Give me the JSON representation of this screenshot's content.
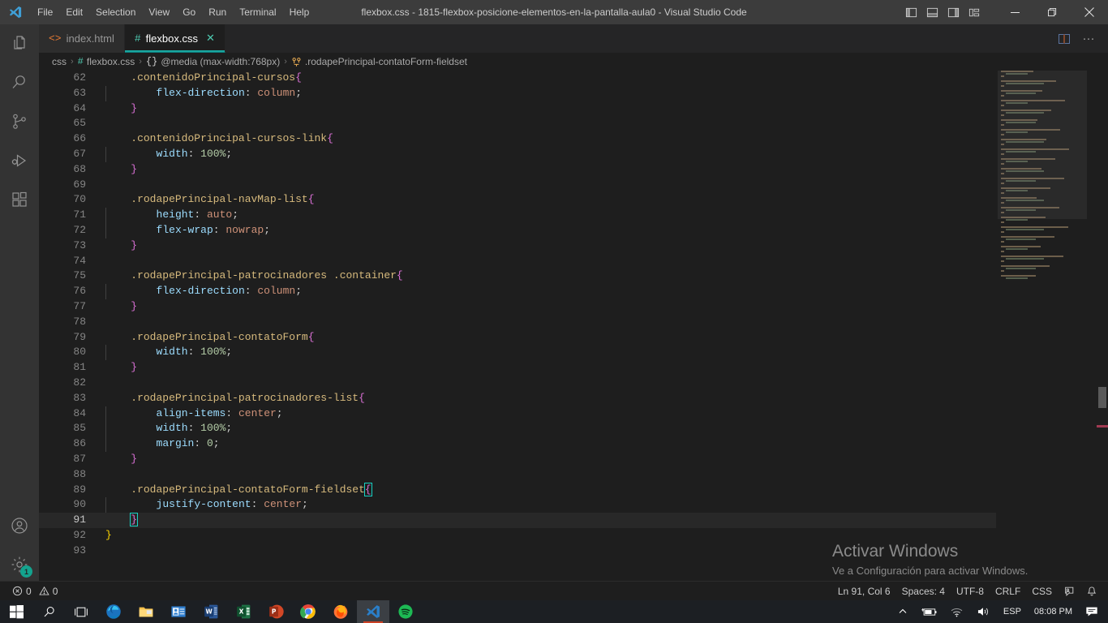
{
  "titlebar": {
    "logo_icon": "vscode-logo-icon",
    "menu": [
      "File",
      "Edit",
      "Selection",
      "View",
      "Go",
      "Run",
      "Terminal",
      "Help"
    ],
    "window_title": "flexbox.css - 1815-flexbox-posicione-elementos-en-la-pantalla-aula0 - Visual Studio Code",
    "layout_buttons": [
      {
        "name": "toggle-primary-sidebar-icon"
      },
      {
        "name": "toggle-panel-icon"
      },
      {
        "name": "toggle-secondary-sidebar-icon"
      },
      {
        "name": "customize-layout-icon"
      }
    ],
    "window_controls": [
      {
        "name": "minimize-button",
        "glyph": "—"
      },
      {
        "name": "maximize-button",
        "glyph": "❐"
      },
      {
        "name": "close-button",
        "glyph": "✕"
      }
    ]
  },
  "activitybar": {
    "items": [
      {
        "name": "explorer",
        "icon": "files-icon",
        "active": false
      },
      {
        "name": "search",
        "icon": "search-icon",
        "active": false
      },
      {
        "name": "source-control",
        "icon": "source-control-icon",
        "active": false
      },
      {
        "name": "run-and-debug",
        "icon": "run-debug-icon",
        "active": false
      },
      {
        "name": "extensions",
        "icon": "extensions-icon",
        "active": false
      }
    ],
    "bottom": [
      {
        "name": "accounts",
        "icon": "account-icon",
        "badge": ""
      },
      {
        "name": "manage",
        "icon": "gear-icon",
        "badge": "1"
      }
    ]
  },
  "tabs": {
    "items": [
      {
        "label": "index.html",
        "icon": "<>",
        "icon_color": "#e37933",
        "active": false,
        "closable": false
      },
      {
        "label": "flexbox.css",
        "icon": "#",
        "icon_color": "#4ec9b0",
        "active": true,
        "closable": true,
        "close_glyph": "✕"
      }
    ],
    "actions": [
      {
        "name": "split-editor-right-icon"
      },
      {
        "name": "more-actions-icon",
        "glyph": "···"
      }
    ]
  },
  "breadcrumb": {
    "separator": "›",
    "segments": [
      {
        "label": "css",
        "icon": ""
      },
      {
        "label": "flexbox.css",
        "icon": "#",
        "icon_color": "#4ec9b0"
      },
      {
        "label": "@media (max-width:768px)",
        "icon": "{}",
        "icon_color": "#cccccc"
      },
      {
        "label": ".rodapePrincipal-contatoForm-fieldset",
        "icon": "css-rule-icon",
        "icon_color": "#e8ab53"
      }
    ]
  },
  "editor": {
    "current_line": 91,
    "lines": [
      {
        "n": 62,
        "indent": 1,
        "guides": 0,
        "tokens": [
          {
            "t": ".contenidoPrincipal-cursos",
            "c": "c-sel"
          },
          {
            "t": "{",
            "c": "c-brace"
          }
        ]
      },
      {
        "n": 63,
        "indent": 2,
        "guides": 1,
        "tokens": [
          {
            "t": "flex-direction",
            "c": "c-prop"
          },
          {
            "t": ": ",
            "c": "c-punct"
          },
          {
            "t": "column",
            "c": "c-val"
          },
          {
            "t": ";",
            "c": "c-punct"
          }
        ]
      },
      {
        "n": 64,
        "indent": 1,
        "guides": 0,
        "tokens": [
          {
            "t": "}",
            "c": "c-brace"
          }
        ]
      },
      {
        "n": 65,
        "indent": 0,
        "guides": 0,
        "tokens": []
      },
      {
        "n": 66,
        "indent": 1,
        "guides": 0,
        "tokens": [
          {
            "t": ".contenidoPrincipal-cursos-link",
            "c": "c-sel"
          },
          {
            "t": "{",
            "c": "c-brace"
          }
        ]
      },
      {
        "n": 67,
        "indent": 2,
        "guides": 1,
        "tokens": [
          {
            "t": "width",
            "c": "c-prop"
          },
          {
            "t": ": ",
            "c": "c-punct"
          },
          {
            "t": "100%",
            "c": "c-num"
          },
          {
            "t": ";",
            "c": "c-punct"
          }
        ]
      },
      {
        "n": 68,
        "indent": 1,
        "guides": 0,
        "tokens": [
          {
            "t": "}",
            "c": "c-brace"
          }
        ]
      },
      {
        "n": 69,
        "indent": 0,
        "guides": 0,
        "tokens": []
      },
      {
        "n": 70,
        "indent": 1,
        "guides": 0,
        "tokens": [
          {
            "t": ".rodapePrincipal-navMap-list",
            "c": "c-sel"
          },
          {
            "t": "{",
            "c": "c-brace"
          }
        ]
      },
      {
        "n": 71,
        "indent": 2,
        "guides": 1,
        "tokens": [
          {
            "t": "height",
            "c": "c-prop"
          },
          {
            "t": ": ",
            "c": "c-punct"
          },
          {
            "t": "auto",
            "c": "c-val"
          },
          {
            "t": ";",
            "c": "c-punct"
          }
        ]
      },
      {
        "n": 72,
        "indent": 2,
        "guides": 1,
        "tokens": [
          {
            "t": "flex-wrap",
            "c": "c-prop"
          },
          {
            "t": ": ",
            "c": "c-punct"
          },
          {
            "t": "nowrap",
            "c": "c-val"
          },
          {
            "t": ";",
            "c": "c-punct"
          }
        ]
      },
      {
        "n": 73,
        "indent": 1,
        "guides": 0,
        "tokens": [
          {
            "t": "}",
            "c": "c-brace"
          }
        ]
      },
      {
        "n": 74,
        "indent": 0,
        "guides": 0,
        "tokens": []
      },
      {
        "n": 75,
        "indent": 1,
        "guides": 0,
        "tokens": [
          {
            "t": ".rodapePrincipal-patrocinadores .container",
            "c": "c-sel"
          },
          {
            "t": "{",
            "c": "c-brace"
          }
        ]
      },
      {
        "n": 76,
        "indent": 2,
        "guides": 1,
        "tokens": [
          {
            "t": "flex-direction",
            "c": "c-prop"
          },
          {
            "t": ": ",
            "c": "c-punct"
          },
          {
            "t": "column",
            "c": "c-val"
          },
          {
            "t": ";",
            "c": "c-punct"
          }
        ]
      },
      {
        "n": 77,
        "indent": 1,
        "guides": 0,
        "tokens": [
          {
            "t": "}",
            "c": "c-brace"
          }
        ]
      },
      {
        "n": 78,
        "indent": 0,
        "guides": 0,
        "tokens": []
      },
      {
        "n": 79,
        "indent": 1,
        "guides": 0,
        "tokens": [
          {
            "t": ".rodapePrincipal-contatoForm",
            "c": "c-sel"
          },
          {
            "t": "{",
            "c": "c-brace"
          }
        ]
      },
      {
        "n": 80,
        "indent": 2,
        "guides": 1,
        "tokens": [
          {
            "t": "width",
            "c": "c-prop"
          },
          {
            "t": ": ",
            "c": "c-punct"
          },
          {
            "t": "100%",
            "c": "c-num"
          },
          {
            "t": ";",
            "c": "c-punct"
          }
        ]
      },
      {
        "n": 81,
        "indent": 1,
        "guides": 0,
        "tokens": [
          {
            "t": "}",
            "c": "c-brace"
          }
        ]
      },
      {
        "n": 82,
        "indent": 0,
        "guides": 0,
        "tokens": []
      },
      {
        "n": 83,
        "indent": 1,
        "guides": 0,
        "tokens": [
          {
            "t": ".rodapePrincipal-patrocinadores-list",
            "c": "c-sel"
          },
          {
            "t": "{",
            "c": "c-brace"
          }
        ]
      },
      {
        "n": 84,
        "indent": 2,
        "guides": 1,
        "tokens": [
          {
            "t": "align-items",
            "c": "c-prop"
          },
          {
            "t": ": ",
            "c": "c-punct"
          },
          {
            "t": "center",
            "c": "c-val"
          },
          {
            "t": ";",
            "c": "c-punct"
          }
        ]
      },
      {
        "n": 85,
        "indent": 2,
        "guides": 1,
        "tokens": [
          {
            "t": "width",
            "c": "c-prop"
          },
          {
            "t": ": ",
            "c": "c-punct"
          },
          {
            "t": "100%",
            "c": "c-num"
          },
          {
            "t": ";",
            "c": "c-punct"
          }
        ]
      },
      {
        "n": 86,
        "indent": 2,
        "guides": 1,
        "tokens": [
          {
            "t": "margin",
            "c": "c-prop"
          },
          {
            "t": ": ",
            "c": "c-punct"
          },
          {
            "t": "0",
            "c": "c-num"
          },
          {
            "t": ";",
            "c": "c-punct"
          }
        ]
      },
      {
        "n": 87,
        "indent": 1,
        "guides": 0,
        "tokens": [
          {
            "t": "}",
            "c": "c-brace"
          }
        ]
      },
      {
        "n": 88,
        "indent": 0,
        "guides": 0,
        "tokens": []
      },
      {
        "n": 89,
        "indent": 1,
        "guides": 0,
        "tokens": [
          {
            "t": ".rodapePrincipal-contatoForm-fieldset",
            "c": "c-sel"
          },
          {
            "t": "{",
            "c": "c-brace",
            "bracket": true
          }
        ]
      },
      {
        "n": 90,
        "indent": 2,
        "guides": 1,
        "tokens": [
          {
            "t": "justify-content",
            "c": "c-prop"
          },
          {
            "t": ": ",
            "c": "c-punct"
          },
          {
            "t": "center",
            "c": "c-val"
          },
          {
            "t": ";",
            "c": "c-punct"
          }
        ]
      },
      {
        "n": 91,
        "indent": 1,
        "guides": 0,
        "tokens": [
          {
            "t": "}",
            "c": "c-brace",
            "bracket": true
          }
        ]
      },
      {
        "n": 92,
        "indent": 0,
        "guides": 0,
        "tokens": [
          {
            "t": "}",
            "c": "c-brace2"
          }
        ]
      },
      {
        "n": 93,
        "indent": 0,
        "guides": 0,
        "tokens": []
      }
    ]
  },
  "watermark": {
    "line1": "Activar Windows",
    "line2": "Ve a Configuración para activar Windows."
  },
  "statusbar": {
    "errors_icon": "error-circle-icon",
    "errors": "0",
    "warnings_icon": "warning-triangle-icon",
    "warnings": "0",
    "cursor_position": "Ln 91, Col 6",
    "indentation": "Spaces: 4",
    "encoding": "UTF-8",
    "eol": "CRLF",
    "language": "CSS",
    "feedback_icon": "feedback-smiley-icon",
    "notifications_icon": "bell-icon"
  },
  "taskbar": {
    "items": [
      {
        "name": "start-button",
        "icon": "windows-logo-icon"
      },
      {
        "name": "search-taskbar",
        "icon": "search-icon"
      },
      {
        "name": "task-view",
        "icon": "task-view-icon"
      },
      {
        "name": "microsoft-edge",
        "icon": "edge-icon"
      },
      {
        "name": "file-explorer",
        "icon": "folder-icon"
      },
      {
        "name": "mail",
        "icon": "mail-icon"
      },
      {
        "name": "microsoft-word",
        "icon": "word-icon"
      },
      {
        "name": "microsoft-excel",
        "icon": "excel-icon"
      },
      {
        "name": "microsoft-powerpoint",
        "icon": "powerpoint-icon"
      },
      {
        "name": "google-chrome",
        "icon": "chrome-icon"
      },
      {
        "name": "mozilla-firefox",
        "icon": "firefox-icon"
      },
      {
        "name": "visual-studio-code",
        "icon": "vscode-icon"
      },
      {
        "name": "spotify",
        "icon": "spotify-icon"
      }
    ],
    "tray": {
      "show_hidden_icons": "chevron-up-icon",
      "battery": "battery-charging-icon",
      "network": "wifi-icon",
      "volume": "speaker-icon",
      "language": "ESP",
      "time": "08:08 PM",
      "action_center": "notification-icon"
    }
  }
}
